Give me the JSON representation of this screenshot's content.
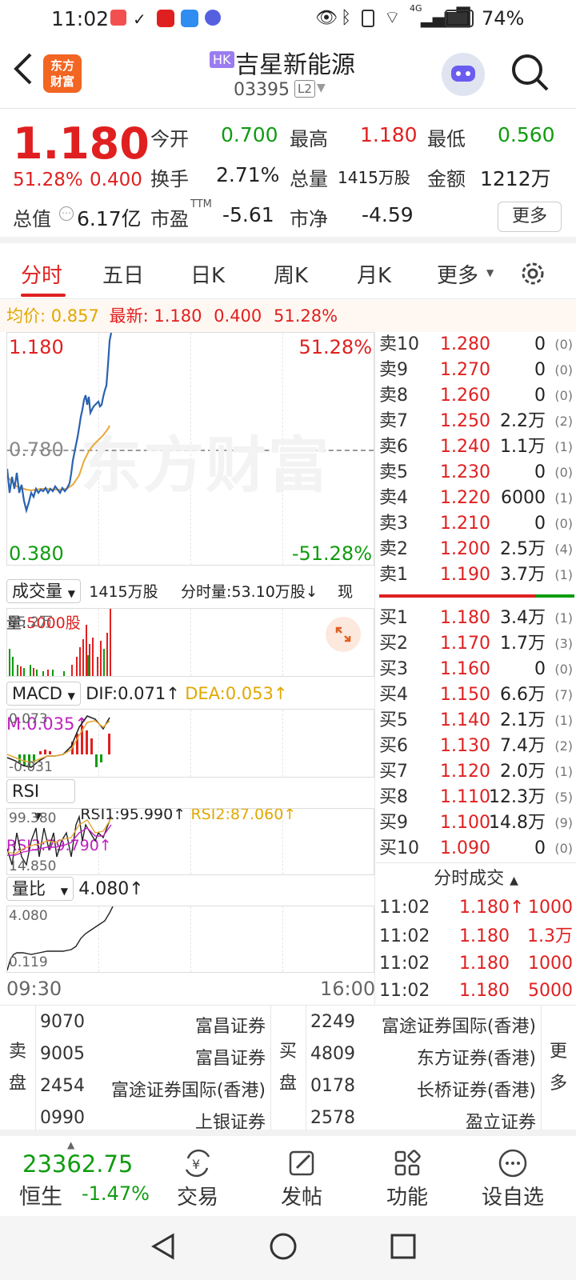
{
  "status_bar": {
    "time": "11:02",
    "battery": "74%",
    "network": "4G"
  },
  "header": {
    "logo_text_top": "东方",
    "logo_text_bottom": "财富",
    "market_badge": "HK",
    "stock_name": "吉星新能源",
    "stock_code": "03395",
    "level_badge": "L2"
  },
  "quote": {
    "price": "1.180",
    "change_pct": "51.28%",
    "change_amt": "0.400",
    "open_label": "今开",
    "open": "0.700",
    "high_label": "最高",
    "high": "1.180",
    "low_label": "最低",
    "low": "0.560",
    "turnover_label": "换手",
    "turnover": "2.71%",
    "volume_label": "总量",
    "volume": "1415万股",
    "amount_label": "金额",
    "amount": "1212万",
    "mktcap_label": "总值",
    "mktcap": "6.17亿",
    "pe_label": "市盈",
    "pe_sup": "TTM",
    "pe": "-5.61",
    "pb_label": "市净",
    "pb": "-4.59",
    "more_button": "更多"
  },
  "tabs": [
    "分时",
    "五日",
    "日K",
    "周K",
    "月K",
    "更多"
  ],
  "info_line": {
    "avg_label": "均价:",
    "avg_value": "0.857",
    "latest_label": "最新:",
    "latest_value": "1.180",
    "change_amt": "0.400",
    "change_pct": "51.28%"
  },
  "price_chart": {
    "y_top": "1.180",
    "y_mid": "0.780",
    "y_bottom": "0.380",
    "pct_top": "51.28%",
    "pct_bottom": "-51.28%",
    "watermark": "东方财富",
    "time_start": "09:30",
    "time_end": "16:00"
  },
  "volume_panel": {
    "selector": "成交量",
    "total": "1415万股",
    "minute_vol": "分时量:53.10万股↓",
    "current_label": "现量:",
    "current_value": "5000股",
    "max_label": "85.2万"
  },
  "macd_panel": {
    "selector": "MACD",
    "dif": "DIF:0.071↑",
    "dea": "DEA:0.053↑",
    "m": "M:0.035↑",
    "top_label": "0.073",
    "bottom_label": "-0.031"
  },
  "rsi_panel": {
    "selector": "RSI",
    "rsi1": "RSI1:95.990↑",
    "rsi2": "RSI2:87.060↑",
    "rsi3": "RSI3:79.790↑",
    "top_label": "99.380",
    "bottom_label": "14.850"
  },
  "ratio_panel": {
    "selector": "量比",
    "value": "4.080↑",
    "top_label": "4.080",
    "bottom_label": "0.119"
  },
  "order_book": {
    "asks": [
      {
        "label": "卖10",
        "price": "1.280",
        "vol": "0",
        "count": "(0)"
      },
      {
        "label": "卖9",
        "price": "1.270",
        "vol": "0",
        "count": "(0)"
      },
      {
        "label": "卖8",
        "price": "1.260",
        "vol": "0",
        "count": "(0)"
      },
      {
        "label": "卖7",
        "price": "1.250",
        "vol": "2.2万",
        "count": "(2)"
      },
      {
        "label": "卖6",
        "price": "1.240",
        "vol": "1.1万",
        "count": "(1)"
      },
      {
        "label": "卖5",
        "price": "1.230",
        "vol": "0",
        "count": "(0)"
      },
      {
        "label": "卖4",
        "price": "1.220",
        "vol": "6000",
        "count": "(1)"
      },
      {
        "label": "卖3",
        "price": "1.210",
        "vol": "0",
        "count": "(0)"
      },
      {
        "label": "卖2",
        "price": "1.200",
        "vol": "2.5万",
        "count": "(4)"
      },
      {
        "label": "卖1",
        "price": "1.190",
        "vol": "3.7万",
        "count": "(1)"
      }
    ],
    "bids": [
      {
        "label": "买1",
        "price": "1.180",
        "vol": "3.4万",
        "count": "(1)"
      },
      {
        "label": "买2",
        "price": "1.170",
        "vol": "1.7万",
        "count": "(3)"
      },
      {
        "label": "买3",
        "price": "1.160",
        "vol": "0",
        "count": "(0)"
      },
      {
        "label": "买4",
        "price": "1.150",
        "vol": "6.6万",
        "count": "(7)"
      },
      {
        "label": "买5",
        "price": "1.140",
        "vol": "2.1万",
        "count": "(1)"
      },
      {
        "label": "买6",
        "price": "1.130",
        "vol": "7.4万",
        "count": "(2)"
      },
      {
        "label": "买7",
        "price": "1.120",
        "vol": "2.0万",
        "count": "(1)"
      },
      {
        "label": "买8",
        "price": "1.110",
        "vol": "12.3万",
        "count": "(5)"
      },
      {
        "label": "买9",
        "price": "1.100",
        "vol": "14.8万",
        "count": "(9)"
      },
      {
        "label": "买10",
        "price": "1.090",
        "vol": "0",
        "count": "(0)"
      }
    ],
    "trades_header": "分时成交",
    "trades": [
      {
        "time": "11:02",
        "price": "1.180↑",
        "vol": "1000"
      },
      {
        "time": "11:02",
        "price": "1.180",
        "vol": "1.3万"
      },
      {
        "time": "11:02",
        "price": "1.180",
        "vol": "1000"
      },
      {
        "time": "11:02",
        "price": "1.180",
        "vol": "5000"
      }
    ]
  },
  "broker_queue": {
    "sell_label_1": "卖",
    "sell_label_2": "盘",
    "buy_label_1": "买",
    "buy_label_2": "盘",
    "more_1": "更",
    "more_2": "多",
    "sell": [
      {
        "code": "9070",
        "name": "富昌证券"
      },
      {
        "code": "9005",
        "name": "富昌证券"
      },
      {
        "code": "2454",
        "name": "富途证券国际(香港)"
      },
      {
        "code": "0990",
        "name": "上银证券"
      }
    ],
    "buy": [
      {
        "code": "2249",
        "name": "富途证券国际(香港)"
      },
      {
        "code": "4809",
        "name": "东方证券(香港)"
      },
      {
        "code": "0178",
        "name": "长桥证券(香港)"
      },
      {
        "code": "2578",
        "name": "盈立证券"
      }
    ]
  },
  "bottom_nav": {
    "index_value": "23362.75",
    "index_name": "恒生",
    "index_change": "-1.47%",
    "items": [
      "交易",
      "发帖",
      "功能",
      "设自选"
    ]
  },
  "colors": {
    "up": "#e02020",
    "down": "#109c10",
    "avg_line": "#e8a838",
    "price_line": "#2a62b0",
    "brand": "#f26522"
  }
}
